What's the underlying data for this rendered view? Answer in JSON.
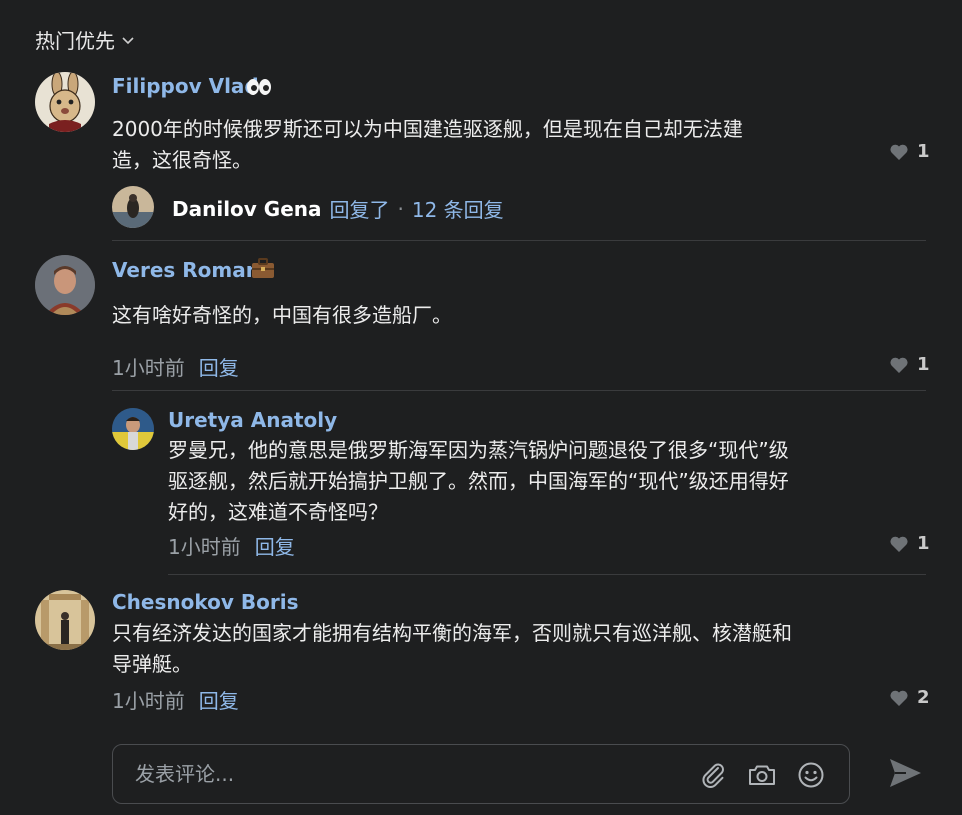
{
  "sort": {
    "label": "热门优先",
    "icon": "chevron-down-icon"
  },
  "comments": [
    {
      "author": "Filippov Vlad",
      "badge": "eyes-emoji",
      "text_lines": [
        "2000年的时候俄罗斯还可以为中国建造驱逐舰，但是现在自己却无法建",
        "造，这很奇怪。"
      ],
      "likes": "1",
      "replies_summary": {
        "replier": "Danilov Gena",
        "action": "回复了",
        "separator": "·",
        "count_label": "12 条回复"
      }
    },
    {
      "author": "Veres Roman",
      "badge": "briefcase-emoji",
      "text_lines": [
        "这有啥好奇怪的，中国有很多造船厂。"
      ],
      "time": "1小时前",
      "reply_label": "回复",
      "likes": "1",
      "replies": [
        {
          "author": "Uretya Anatoly",
          "text_lines": [
            "罗曼兄，他的意思是俄罗斯海军因为蒸汽锅炉问题退役了很多“现代”级",
            "驱逐舰，然后就开始搞护卫舰了。然而，中国海军的“现代”级还用得好",
            "好的，这难道不奇怪吗？"
          ],
          "time": "1小时前",
          "reply_label": "回复",
          "likes": "1"
        }
      ]
    },
    {
      "author": "Chesnokov Boris",
      "text_lines": [
        "只有经济发达的国家才能拥有结构平衡的海军，否则就只有巡洋舰、核潜艇和",
        "导弹艇。"
      ],
      "time": "1小时前",
      "reply_label": "回复",
      "likes": "2"
    }
  ],
  "composer": {
    "placeholder": "发表评论...",
    "icons": [
      "paperclip-icon",
      "camera-icon",
      "smile-icon"
    ],
    "send_icon": "send-icon"
  },
  "colors": {
    "background": "#1e1f20",
    "author_name": "#8fb8e8",
    "link": "#8fb8e8",
    "text": "#ececec",
    "muted": "#9aa0a6",
    "divider": "#3a3b3d"
  }
}
